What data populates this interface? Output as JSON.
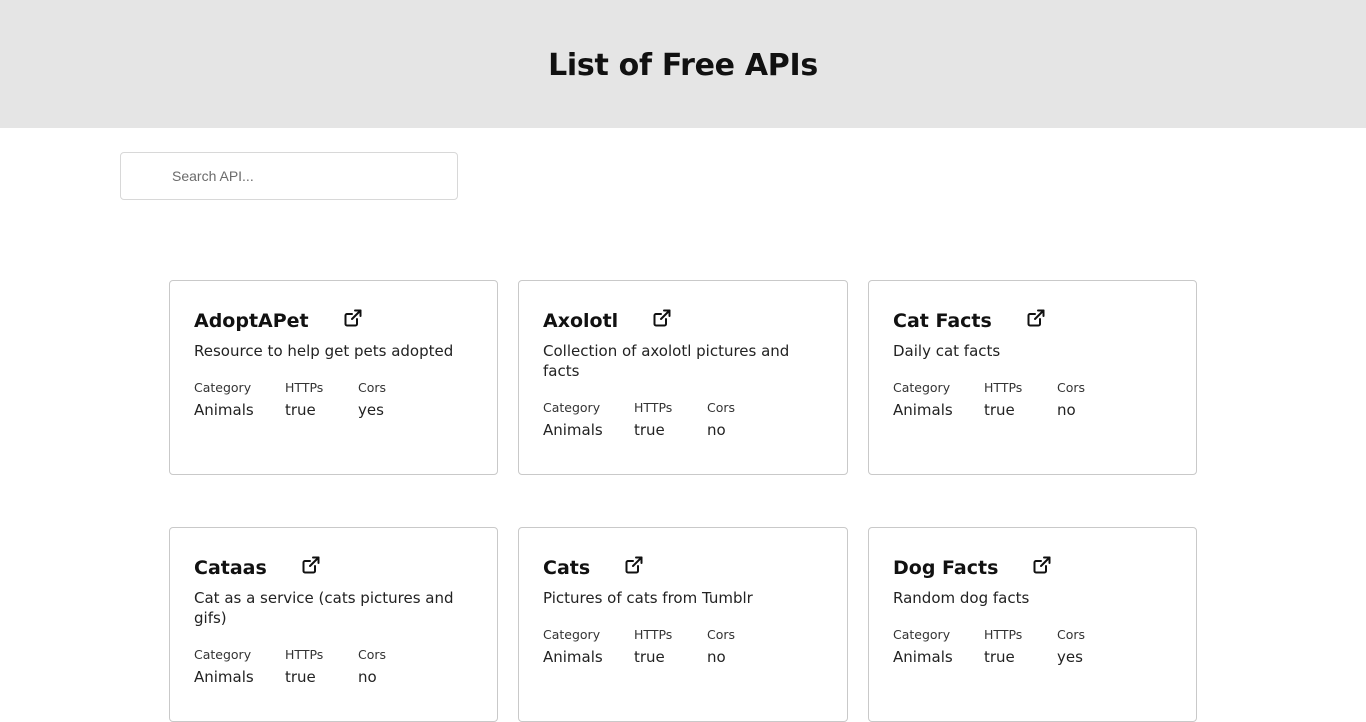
{
  "header": {
    "title": "List of Free APIs"
  },
  "search": {
    "placeholder": "Search API..."
  },
  "labels": {
    "category": "Category",
    "https": "HTTPs",
    "cors": "Cors"
  },
  "cards": [
    {
      "title": "AdoptAPet",
      "description": "Resource to help get pets adopted",
      "category": "Animals",
      "https": "true",
      "cors": "yes"
    },
    {
      "title": "Axolotl",
      "description": "Collection of axolotl pictures and facts",
      "category": "Animals",
      "https": "true",
      "cors": "no"
    },
    {
      "title": "Cat Facts",
      "description": "Daily cat facts",
      "category": "Animals",
      "https": "true",
      "cors": "no"
    },
    {
      "title": "Cataas",
      "description": "Cat as a service (cats pictures and gifs)",
      "category": "Animals",
      "https": "true",
      "cors": "no"
    },
    {
      "title": "Cats",
      "description": "Pictures of cats from Tumblr",
      "category": "Animals",
      "https": "true",
      "cors": "no"
    },
    {
      "title": "Dog Facts",
      "description": "Random dog facts",
      "category": "Animals",
      "https": "true",
      "cors": "yes"
    }
  ]
}
